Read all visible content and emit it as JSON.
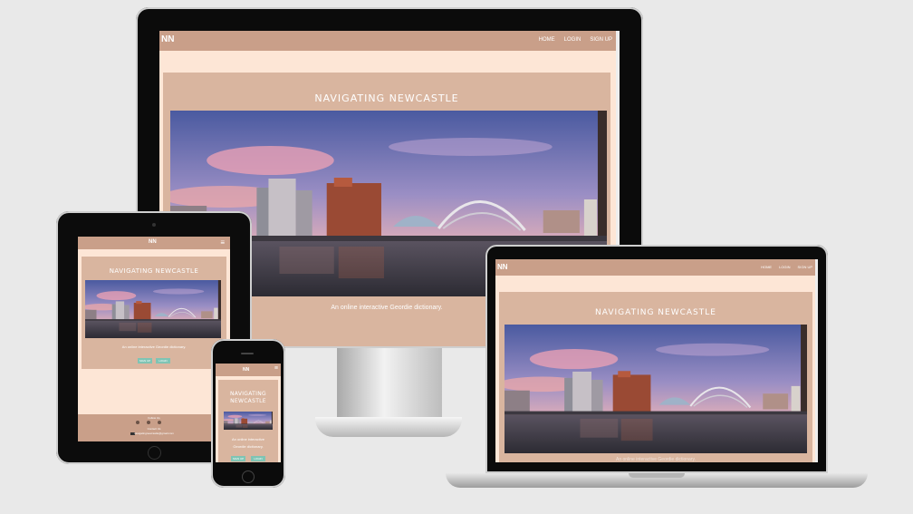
{
  "site": {
    "brand": "NN",
    "nav": [
      "HOME",
      "LOGIN",
      "SIGN UP"
    ],
    "title": "NAVIGATING NEWCASTLE",
    "title_stacked": [
      "NAVIGATING",
      "NEWCASTLE"
    ],
    "subtitle": "An online interactive Geordie dictionary.",
    "subtitle_stacked": [
      "An online interactive",
      "Geordie dictionary."
    ],
    "buttons": [
      "SIGN UP",
      "LOGIN"
    ],
    "follow": "Follow Us",
    "contact": "Contact Us",
    "email": "navigatingnewcastle@gmail.com"
  },
  "colors": {
    "page_bg": "#fde6d6",
    "nav_bg": "#c99f89",
    "card_bg": "#d9b59f",
    "button": "#7fc4b4"
  },
  "icons": [
    "menu-icon",
    "instagram-icon",
    "facebook-icon",
    "twitter-icon",
    "email-icon"
  ]
}
